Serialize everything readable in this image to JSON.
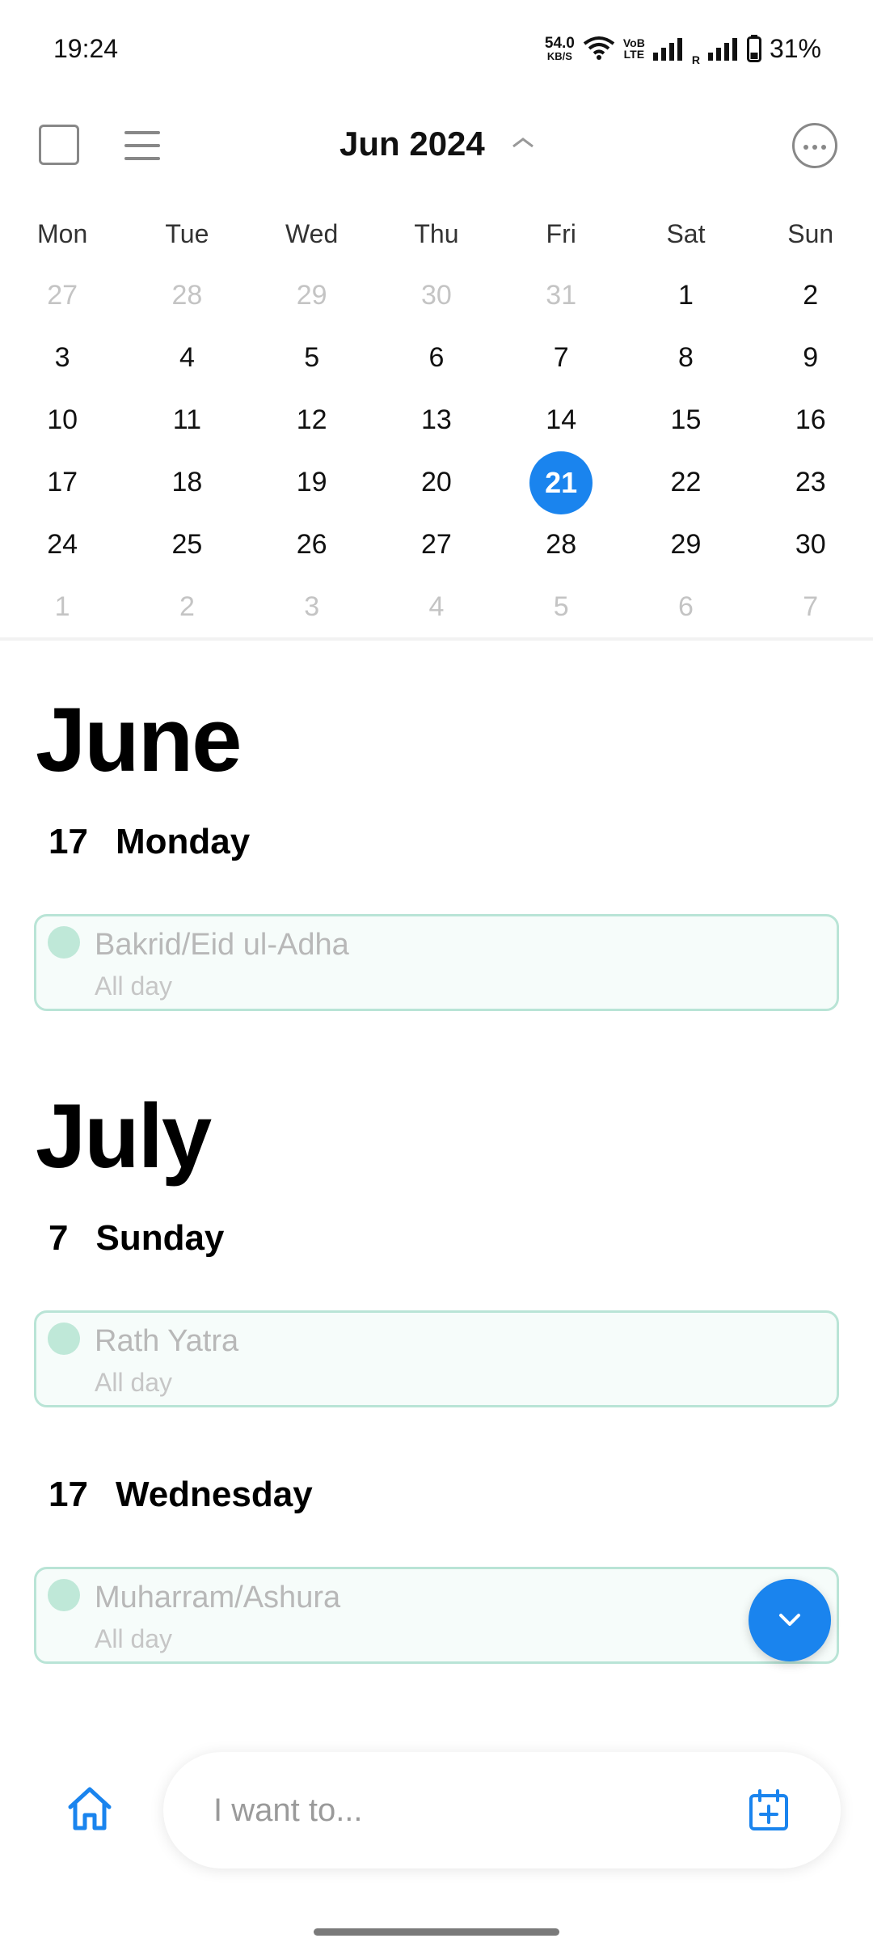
{
  "status_bar": {
    "time": "19:24",
    "net_speed_value": "54.0",
    "net_speed_unit": "KB/S",
    "volte_top": "VoB",
    "volte_bottom": "LTE",
    "roaming": "R",
    "battery": "31%"
  },
  "toolbar": {
    "title": "Jun 2024"
  },
  "calendar": {
    "weekdays": [
      "Mon",
      "Tue",
      "Wed",
      "Thu",
      "Fri",
      "Sat",
      "Sun"
    ],
    "weeks": [
      [
        {
          "d": "27",
          "m": true
        },
        {
          "d": "28",
          "m": true
        },
        {
          "d": "29",
          "m": true
        },
        {
          "d": "30",
          "m": true
        },
        {
          "d": "31",
          "m": true
        },
        {
          "d": "1"
        },
        {
          "d": "2"
        }
      ],
      [
        {
          "d": "3"
        },
        {
          "d": "4"
        },
        {
          "d": "5"
        },
        {
          "d": "6"
        },
        {
          "d": "7"
        },
        {
          "d": "8"
        },
        {
          "d": "9"
        }
      ],
      [
        {
          "d": "10"
        },
        {
          "d": "11"
        },
        {
          "d": "12"
        },
        {
          "d": "13"
        },
        {
          "d": "14"
        },
        {
          "d": "15"
        },
        {
          "d": "16"
        }
      ],
      [
        {
          "d": "17"
        },
        {
          "d": "18"
        },
        {
          "d": "19"
        },
        {
          "d": "20"
        },
        {
          "d": "21",
          "today": true
        },
        {
          "d": "22"
        },
        {
          "d": "23"
        }
      ],
      [
        {
          "d": "24"
        },
        {
          "d": "25"
        },
        {
          "d": "26"
        },
        {
          "d": "27"
        },
        {
          "d": "28"
        },
        {
          "d": "29"
        },
        {
          "d": "30"
        }
      ],
      [
        {
          "d": "1",
          "m": true
        },
        {
          "d": "2",
          "m": true
        },
        {
          "d": "3",
          "m": true
        },
        {
          "d": "4",
          "m": true
        },
        {
          "d": "5",
          "m": true
        },
        {
          "d": "6",
          "m": true
        },
        {
          "d": "7",
          "m": true
        }
      ]
    ]
  },
  "agenda": {
    "june": {
      "month": "June",
      "day1": {
        "num": "17",
        "weekday": "Monday",
        "event_title": "Bakrid/Eid ul-Adha",
        "event_time": "All day"
      }
    },
    "july": {
      "month": "July",
      "day1": {
        "num": "7",
        "weekday": "Sunday",
        "event_title": "Rath Yatra",
        "event_time": "All day"
      },
      "day2": {
        "num": "17",
        "weekday": "Wednesday",
        "event_title": "Muharram/Ashura",
        "event_time": "All day"
      }
    }
  },
  "bottom": {
    "input_placeholder": "I want to..."
  },
  "colors": {
    "accent": "#1a84ee",
    "event_border": "#b9e4d6",
    "event_dot": "#bfe8d8"
  }
}
